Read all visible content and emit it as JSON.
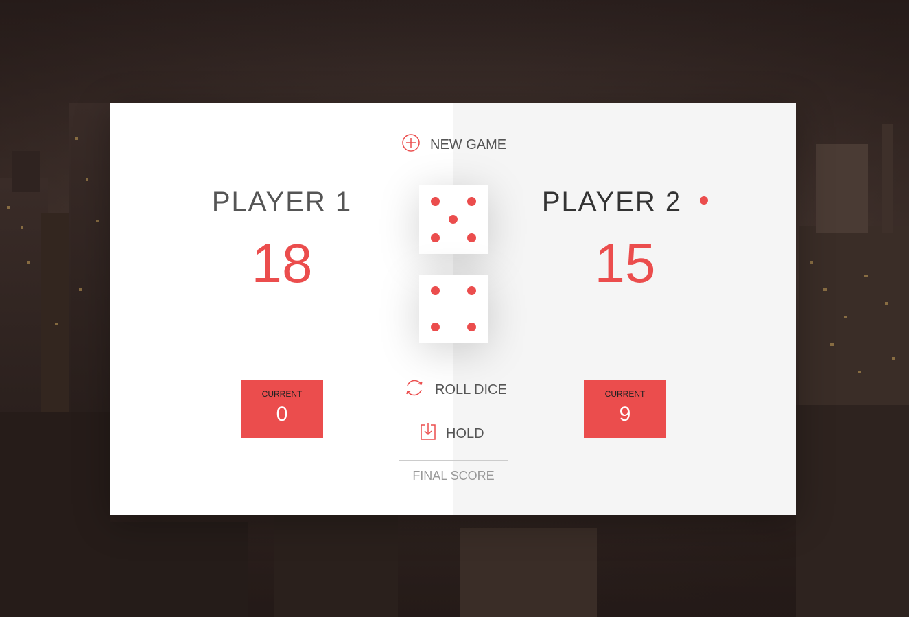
{
  "controls": {
    "new_game": "NEW GAME",
    "roll_dice": "ROLL DICE",
    "hold": "HOLD",
    "final_score_placeholder": "FINAL SCORE"
  },
  "players": [
    {
      "name": "PLAYER 1",
      "score": "18",
      "current_label": "CURRENT",
      "current": "0",
      "active": false
    },
    {
      "name": "PLAYER 2",
      "score": "15",
      "current_label": "CURRENT",
      "current": "9",
      "active": true
    }
  ],
  "dice": [
    5,
    4
  ],
  "colors": {
    "accent": "#EB4D4D",
    "left_panel": "#ffffff",
    "right_panel": "#f5f5f5"
  },
  "icons": {
    "new_game": "plus-circle-icon",
    "roll_dice": "refresh-icon",
    "hold": "download-icon",
    "active_player": "active-dot-icon"
  }
}
